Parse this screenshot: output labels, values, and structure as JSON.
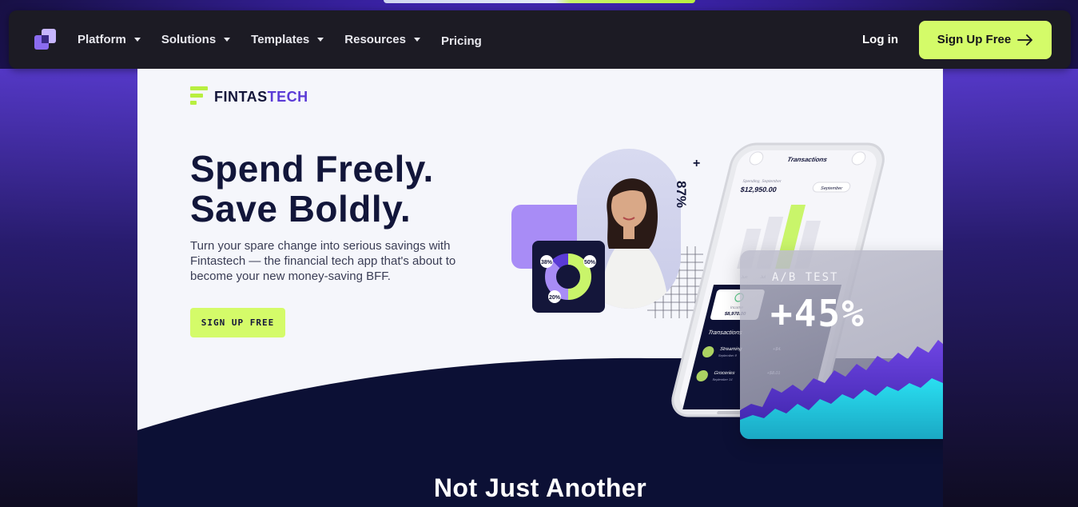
{
  "nav": {
    "items": [
      {
        "label": "Platform",
        "has_caret": true
      },
      {
        "label": "Solutions",
        "has_caret": true
      },
      {
        "label": "Templates",
        "has_caret": true
      },
      {
        "label": "Resources",
        "has_caret": true
      },
      {
        "label": "Pricing",
        "has_caret": false
      }
    ],
    "login_label": "Log in",
    "signup_label": "Sign Up Free",
    "signup_icon": "arrow-right-icon"
  },
  "hero": {
    "brand_prefix": "FINTAS",
    "brand_suffix": "TECH",
    "headline_line1": "Spend Freely.",
    "headline_line2": "Save Boldly.",
    "subtext": "Turn your spare change into serious savings with Fintastech — the financial tech app that's about to become your new money-saving BFF.",
    "cta_label": "SIGN UP FREE"
  },
  "visual": {
    "percent_87": "87%",
    "plus": "+",
    "donut_labels": [
      "38%",
      "50%",
      "20%"
    ],
    "phone": {
      "title": "Transactions",
      "spending_label": "Spending, September",
      "spending_value": "$12,950.00",
      "month_select": "September",
      "months": [
        "Jun",
        "Jul"
      ],
      "income_label": "Income",
      "income_value": "$8,970.00",
      "section_title": "Transactions",
      "rows": [
        {
          "name": "Streaming",
          "date": "September 9",
          "amount": "+$4."
        },
        {
          "name": "Groceries",
          "date": "September 14",
          "amount": "+$8.01"
        }
      ]
    },
    "ab_test_label": "A/B TEST",
    "ab_test_value": "+45%"
  },
  "section": {
    "title": "Not Just Another"
  },
  "colors": {
    "accent_lime": "#d4fb69",
    "brand_purple": "#5b3bd6",
    "navy": "#0c1035"
  }
}
